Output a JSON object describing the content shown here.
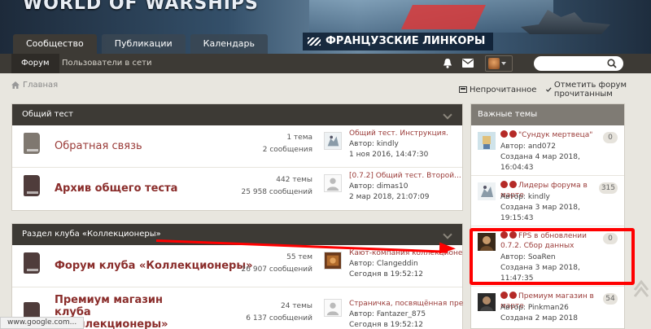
{
  "banner": {
    "logo": "WORLD OF WARSHIPS",
    "promo": "ФРАНЦУЗСКИЕ ЛИНКОРЫ"
  },
  "tabs": [
    "Сообщество",
    "Публикации",
    "Календарь"
  ],
  "subnav": [
    "Форум",
    "Пользователи в сети"
  ],
  "breadcrumb": "Главная",
  "actions": {
    "unread": "Непрочитанное",
    "mark_read": "Отметить форум прочитанным"
  },
  "categories": [
    {
      "title": "Общий тест",
      "forums": [
        {
          "name": "Обратная связь",
          "stats": [
            "1 тема",
            "2 сообщения"
          ],
          "last": [
            "Общий тест. Инструкция.",
            "Автор: kindly",
            "1 ноя 2016, 14:47:30"
          ]
        },
        {
          "name": "Архив общего теста",
          "stats": [
            "442 темы",
            "25 958 сообщений"
          ],
          "last": [
            "[0.7.2] Общий тест. Второй...",
            "Автор: dimas10",
            "2 мар 2018, 21:07:09"
          ]
        }
      ]
    },
    {
      "title": "Раздел клуба «Коллекционеры»",
      "forums": [
        {
          "name": "Форум клуба «Коллекционеры»",
          "stats": [
            "55 тем",
            "26 907 сообщений"
          ],
          "last": [
            "Кают-компания коллекционер...",
            "Автор: Clangeddin",
            "Сегодня в 19:52:12"
          ]
        },
        {
          "name": "Премиум магазин клуба «Коллекционеры»",
          "stats": [
            "24 темы",
            "6 137 сообщений"
          ],
          "last": [
            "Страничка, посвящённая пре...",
            "Автор: Fantazer_875",
            "Сегодня в 19:52:12"
          ]
        }
      ]
    }
  ],
  "sidebar": {
    "title": "Важные темы",
    "topics": [
      {
        "title": "\"Сундук мертвеца\"",
        "author": "Автор: and072",
        "created": "Создана 4 мар 2018, 16:04:43",
        "count": "0"
      },
      {
        "title": "Лидеры форума в марте",
        "author": "Автор: kindly",
        "created": "Создана 3 мар 2018, 19:15:43",
        "count": "315"
      },
      {
        "title": "FPS в обновлении 0.7.2. Сбор данных",
        "author": "Автор: SoaRen",
        "created": "Создана 3 мар 2018, 11:47:35",
        "count": "0"
      },
      {
        "title": "Премиум магазин в марте",
        "author": "Автор: Pinkman26",
        "created": "Создана 2 мар 2018",
        "count": "54"
      }
    ]
  },
  "status_url": "www.google.com..."
}
